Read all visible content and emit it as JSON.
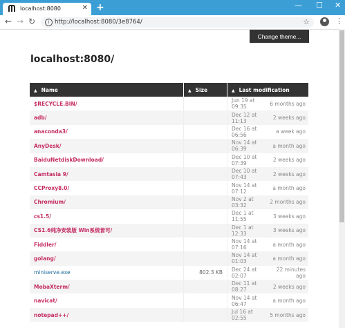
{
  "browser": {
    "tab_title": "localhost:8080",
    "new_tab": "+",
    "url": "http://localhost:8080/3e8764/"
  },
  "theme_button": "Change theme...",
  "page_title": "localhost:8080/",
  "columns": {
    "name": "Name",
    "size": "Size",
    "modified": "Last modification"
  },
  "entries": [
    {
      "name": "$RECYCLE.BIN/",
      "size": "",
      "date": "Jun 19 at 09:35",
      "relative": "6 months ago"
    },
    {
      "name": "adb/",
      "size": "",
      "date": "Dec 12 at 11:13",
      "relative": "2 weeks ago"
    },
    {
      "name": "anaconda3/",
      "size": "",
      "date": "Dec 16 at 06:56",
      "relative": "a week ago"
    },
    {
      "name": "AnyDesk/",
      "size": "",
      "date": "Nov 14 at 06:39",
      "relative": "a month ago"
    },
    {
      "name": "BaiduNetdiskDownload/",
      "size": "",
      "date": "Dec 10 at 07:39",
      "relative": "2 weeks ago"
    },
    {
      "name": "Camtasia 9/",
      "size": "",
      "date": "Dec 10 at 07:43",
      "relative": "2 weeks ago"
    },
    {
      "name": "CCProxy8.0/",
      "size": "",
      "date": "Nov 14 at 07:12",
      "relative": "a month ago"
    },
    {
      "name": "Chromium/",
      "size": "",
      "date": "Nov 2 at 03:32",
      "relative": "2 months ago"
    },
    {
      "name": "cs1.5/",
      "size": "",
      "date": "Dec 1 at 11:55",
      "relative": "3 weeks ago"
    },
    {
      "name": "CS1.6纯净安装版 Win系统皆可/",
      "size": "",
      "date": "Dec 1 at 12:33",
      "relative": "3 weeks ago"
    },
    {
      "name": "Fiddler/",
      "size": "",
      "date": "Nov 14 at 07:16",
      "relative": "a month ago"
    },
    {
      "name": "golang/",
      "size": "",
      "date": "Nov 14 at 01:03",
      "relative": "a month ago"
    },
    {
      "name": "miniserve.exe",
      "size": "802.3 KB",
      "date": "Dec 24 at 02:07",
      "relative": "22 minutes ago",
      "is_file": true
    },
    {
      "name": "MobaXterm/",
      "size": "",
      "date": "Dec 11 at 08:27",
      "relative": "2 weeks ago"
    },
    {
      "name": "navicat/",
      "size": "",
      "date": "Nov 14 at 06:47",
      "relative": "a month ago"
    },
    {
      "name": "notepad++/",
      "size": "",
      "date": "Jul 16 at 02:55",
      "relative": "5 months ago"
    }
  ]
}
